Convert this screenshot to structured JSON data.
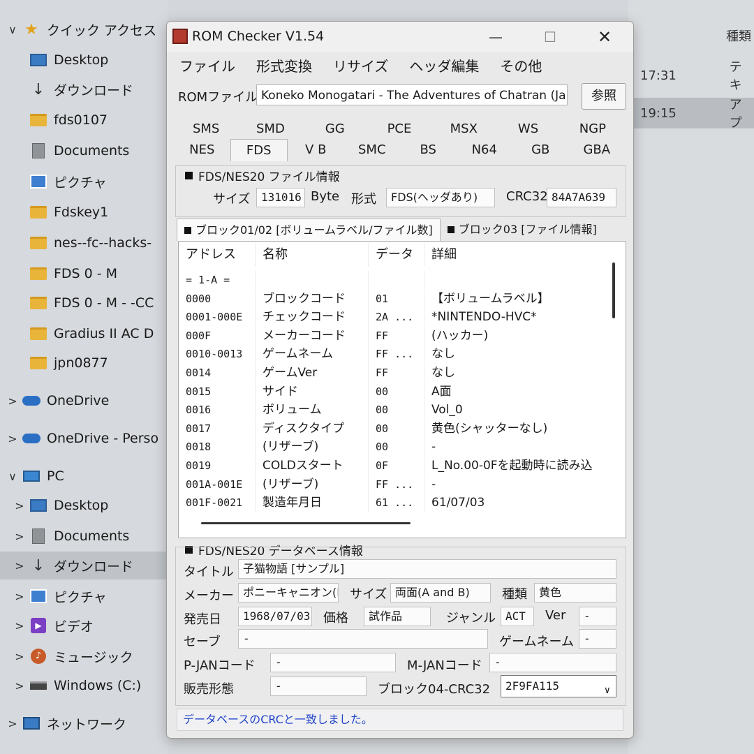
{
  "explorer": {
    "nav_items": [
      {
        "label": "クイック アクセス",
        "icon": "star-icon",
        "chevron": "∨"
      },
      {
        "label": "Desktop",
        "icon": "desktop-icon"
      },
      {
        "label": "ダウンロード",
        "icon": "download-icon"
      },
      {
        "label": "fds0107",
        "icon": "folder-icon"
      },
      {
        "label": "Documents",
        "icon": "documents-icon"
      },
      {
        "label": "ピクチャ",
        "icon": "pictures-icon"
      },
      {
        "label": "Fdskey1",
        "icon": "folder-icon"
      },
      {
        "label": "nes--fc--hacks-",
        "icon": "folder-icon"
      },
      {
        "label": "FDS 0 - M",
        "icon": "folder-icon"
      },
      {
        "label": "FDS 0 - M - -CC",
        "icon": "folder-icon"
      },
      {
        "label": "Gradius II AC D",
        "icon": "folder-icon"
      },
      {
        "label": "jpn0877",
        "icon": "folder-icon"
      },
      {
        "label": "OneDrive",
        "icon": "cloud-icon",
        "chevron": ">"
      },
      {
        "label": "OneDrive - Perso",
        "icon": "cloud-icon",
        "chevron": ">"
      },
      {
        "label": "PC",
        "icon": "pc-icon",
        "chevron": "∨"
      },
      {
        "label": "Desktop",
        "icon": "desktop-icon",
        "chevron": ">"
      },
      {
        "label": "Documents",
        "icon": "documents-icon",
        "chevron": ">"
      },
      {
        "label": "ダウンロード",
        "icon": "download-icon",
        "chevron": ">"
      },
      {
        "label": "ピクチャ",
        "icon": "pictures-icon",
        "chevron": ">"
      },
      {
        "label": "ビデオ",
        "icon": "video-icon",
        "chevron": ">"
      },
      {
        "label": "ミュージック",
        "icon": "music-icon",
        "chevron": ">"
      },
      {
        "label": "Windows (C:)",
        "icon": "drive-icon",
        "chevron": ">"
      },
      {
        "label": "ネットワーク",
        "icon": "network-icon",
        "chevron": ">"
      }
    ],
    "file_header": "種類",
    "file_rows": [
      {
        "time": "17:31",
        "type": "テキ"
      },
      {
        "time": "19:15",
        "type": "アプ"
      }
    ]
  },
  "window": {
    "title": "ROM Checker V1.54",
    "minimize": "—",
    "maximize": "☐",
    "close": "✕",
    "menu": [
      "ファイル",
      "形式変換",
      "リサイズ",
      "ヘッダ編集",
      "その他"
    ],
    "rom_file_label": "ROMファイル",
    "rom_file_value": "Koneko Monogatari - The Adventures of Chatran (Japan)",
    "browse_label": "参照",
    "tabs_row1": [
      "SMS",
      "SMD",
      "GG",
      "PCE",
      "MSX",
      "WS",
      "NGP"
    ],
    "tabs_row2": [
      "NES",
      "FDS",
      "V B",
      "SMC",
      "BS",
      "N64",
      "GB",
      "GBA"
    ],
    "active_tab": "FDS",
    "fds_info": {
      "title": "FDS/NES20 ファイル情報",
      "size_label": "サイズ",
      "size_value": "131016",
      "size_unit": "Byte",
      "format_label": "形式",
      "format_value": "FDS(ヘッダあり)",
      "crc_label": "CRC32",
      "crc_value": "84A7A639"
    },
    "block_tabs": [
      "ブロック01/02 [ボリュームラベル/ファイル数]",
      "ブロック03 [ファイル情報]"
    ],
    "list": {
      "headers": [
        "アドレス",
        "名称",
        "データ",
        "詳細"
      ],
      "rows": [
        [
          "= 1-A =",
          "",
          "",
          ""
        ],
        [
          "0000",
          "ブロックコード",
          "01",
          "【ボリュームラベル】"
        ],
        [
          "0001-000E",
          "チェックコード",
          "2A ...",
          "*NINTENDO-HVC*"
        ],
        [
          "000F",
          "メーカーコード",
          "FF",
          "(ハッカー)"
        ],
        [
          "0010-0013",
          "ゲームネーム",
          "FF ...",
          "なし"
        ],
        [
          "0014",
          "ゲームVer",
          "FF",
          "なし"
        ],
        [
          "0015",
          "サイド",
          "00",
          "A面"
        ],
        [
          "0016",
          "ボリューム",
          "00",
          "Vol_0"
        ],
        [
          "0017",
          "ディスクタイプ",
          "00",
          "黄色(シャッターなし)"
        ],
        [
          "0018",
          "(リザーブ)",
          "00",
          "-"
        ],
        [
          "0019",
          "COLDスタート",
          "0F",
          "L_No.00-0Fを起動時に読み込"
        ],
        [
          "001A-001E",
          "(リザーブ)",
          "FF ...",
          "-"
        ],
        [
          "001F-0021",
          "製造年月日",
          "61 ...",
          "61/07/03"
        ]
      ]
    },
    "db": {
      "title": "FDS/NES20 データベース情報",
      "title_label": "タイトル",
      "title_value": "子猫物語 [サンプル]",
      "maker_label": "メーカー",
      "maker_value": "ポニーキャニオン(F",
      "size_label": "サイズ",
      "size_value": "両面(A and B)",
      "kind_label": "種類",
      "kind_value": "黄色",
      "release_label": "発売日",
      "release_value": "1968/07/03",
      "price_label": "価格",
      "price_value": "試作品",
      "genre_label": "ジャンル",
      "genre_value": "ACT",
      "ver_label": "Ver",
      "ver_value": "-",
      "save_label": "セーブ",
      "save_value": "-",
      "gamename_label": "ゲームネーム",
      "gamename_value": "-",
      "pjan_label": "P-JANコード",
      "pjan_value": "-",
      "mjan_label": "M-JANコード",
      "mjan_value": "-",
      "sales_label": "販売形態",
      "sales_value": "-",
      "block04_label": "ブロック04-CRC32",
      "block04_value": "2F9FA115",
      "dropdown_icon": "chevron-down-icon"
    },
    "status": "データベースのCRCと一致しました。"
  }
}
